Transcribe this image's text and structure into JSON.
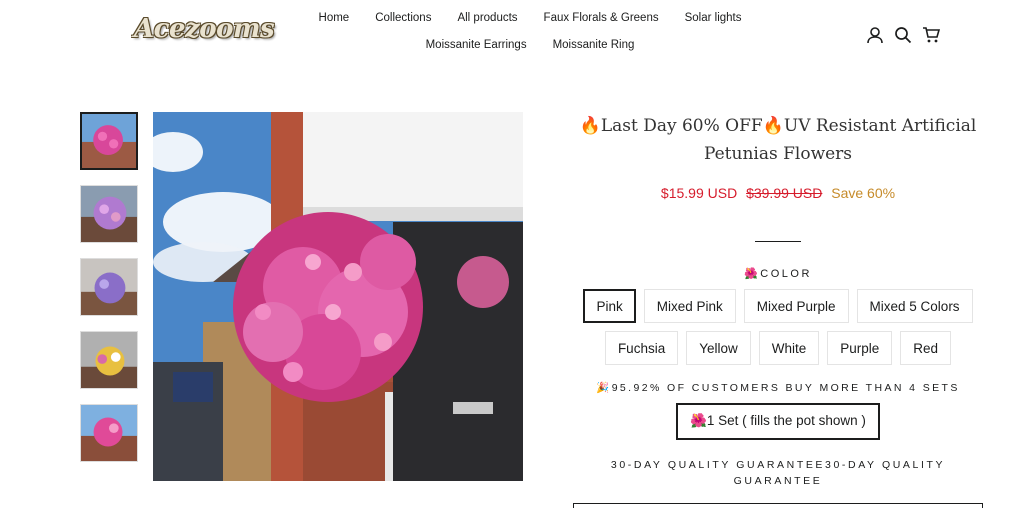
{
  "brand": {
    "logo_text": "Acezooms"
  },
  "nav": {
    "row1": [
      "Home",
      "Collections",
      "All products",
      "Faux Florals & Greens",
      "Solar lights"
    ],
    "row2": [
      "Moissanite Earrings",
      "Moissanite Ring"
    ]
  },
  "header_icons": [
    "user-icon",
    "search-icon",
    "cart-icon"
  ],
  "product": {
    "title": "🔥Last Day 60% OFF🔥UV Resistant Artificial Petunias Flowers",
    "price_sale": "$15.99 USD",
    "price_compare": "$39.99 USD",
    "price_save": "Save 60%",
    "color_label": "🌺COLOR",
    "colors_row1": [
      "Pink",
      "Mixed Pink",
      "Mixed Purple",
      "Mixed 5 Colors"
    ],
    "colors_row2": [
      "Fuchsia",
      "Yellow",
      "White",
      "Purple",
      "Red"
    ],
    "selected_color": "Pink",
    "customers_label": "🎉95.92% OF CUSTOMERS BUY MORE THAN 4 SETS",
    "set_option": "🌺1 Set ( fills the pot shown )",
    "guarantee": "30-DAY QUALITY GUARANTEE30-DAY QUALITY GUARANTEE"
  },
  "colors": {
    "sale": "#d61c2c",
    "save": "#c68b2a",
    "text": "#1c1d1d"
  }
}
